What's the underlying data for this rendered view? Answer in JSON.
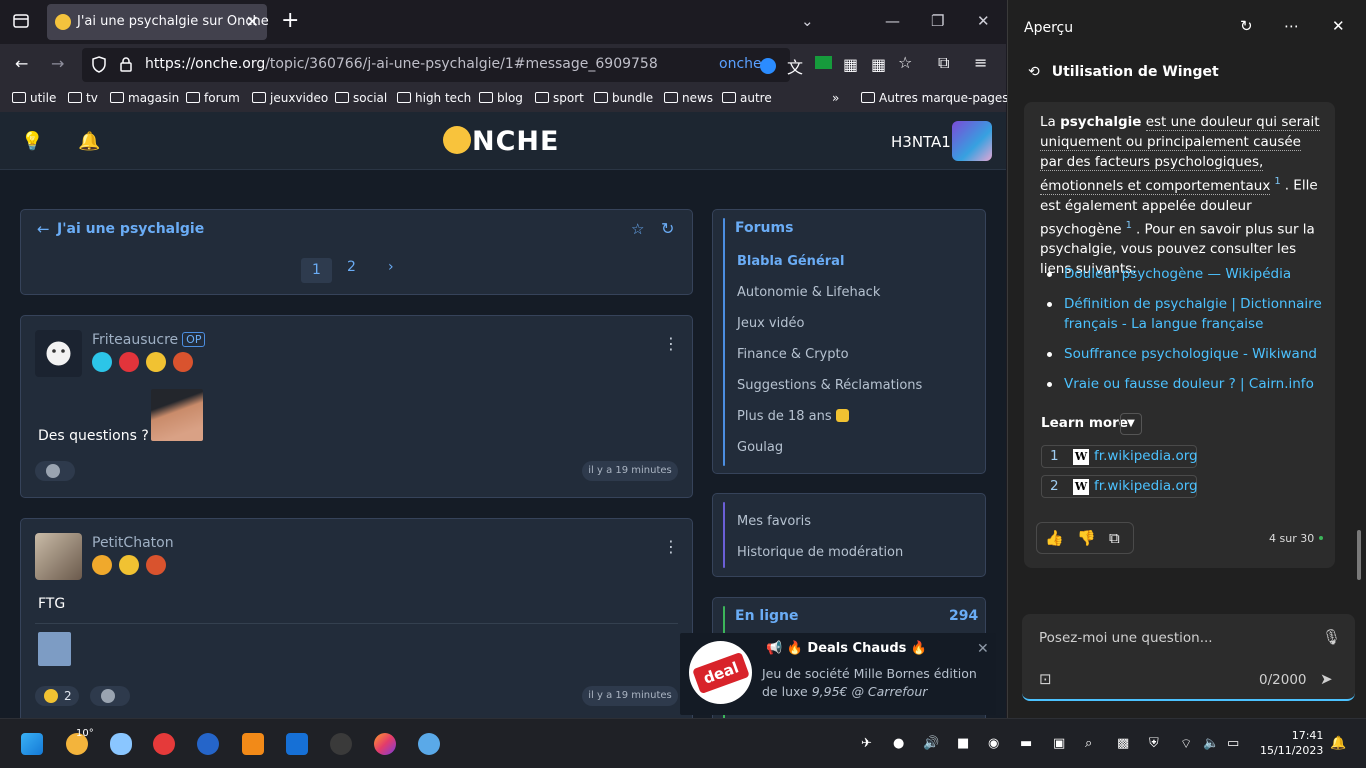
{
  "browser": {
    "tab_title": "J'ai une psychalgie sur Onche",
    "url_host": "https://onche.org",
    "url_path": "/topic/360766/j-ai-une-psychalgie/1#message_6909758",
    "url_badge": "onche",
    "bookmarks": [
      "utile",
      "tv",
      "magasin",
      "forum",
      "jeuxvideo",
      "social",
      "high tech",
      "blog",
      "sport",
      "bundle",
      "news",
      "autre"
    ],
    "other_bookmarks": "Autres marque-pages"
  },
  "site": {
    "logo": "NCHE",
    "username": "H3NTA1"
  },
  "topic": {
    "title": "J'ai une psychalgie",
    "pages": [
      "1",
      "2"
    ],
    "next": "›"
  },
  "posts": [
    {
      "author": "Friteausucre",
      "op_badge": "OP",
      "text": "Des questions ?",
      "reaction_count": "",
      "time": "il y a 19 minutes"
    },
    {
      "author": "PetitChaton",
      "text": "FTG",
      "reaction_count": "2",
      "time": "il y a 19 minutes"
    }
  ],
  "forums": {
    "title": "Forums",
    "items": [
      "Blabla Général",
      "Autonomie & Lifehack",
      "Jeux vidéo",
      "Finance & Crypto",
      "Suggestions & Réclamations",
      "Plus de 18 ans",
      "Goulag"
    ],
    "favs": [
      "Mes favoris",
      "Historique de modération"
    ],
    "online_label": "En ligne",
    "online_count": "294"
  },
  "notification": {
    "title": "📢 🔥 Deals Chauds 🔥",
    "body": "Jeu de société Mille Bornes édition de luxe",
    "price": "9,95€ @ Carrefour",
    "icon_text": "deal"
  },
  "sidebar": {
    "title": "Aperçu",
    "history_title": "Utilisation de Winget",
    "answer": {
      "p1": "La",
      "bold": "psychalgie",
      "p2": "est une douleur qui serait uniquement ou principalement causée par des facteurs psychologiques, émotionnels et comportementaux",
      "p3": ". Elle est également appelée douleur psychogène",
      "p4": ". Pour en savoir plus sur la psychalgie, vous pouvez consulter les liens suivants:",
      "cite": "1"
    },
    "links": [
      "Douleur psychogène — Wikipédia",
      "Définition de psychalgie | Dictionnaire français - La langue française",
      "Souffrance psychologique - Wikiwand",
      "Vraie ou fausse douleur ? | Cairn.info"
    ],
    "learn_more": "Learn more",
    "sources": [
      {
        "n": "1",
        "domain": "fr.wikipedia.org"
      },
      {
        "n": "2",
        "domain": "fr.wikipedia.org"
      }
    ],
    "count": "4 sur 30",
    "input_placeholder": "Posez-moi une question...",
    "char_count": "0/2000"
  },
  "taskbar": {
    "temp": "10°",
    "time": "17:41",
    "date": "15/11/2023"
  }
}
